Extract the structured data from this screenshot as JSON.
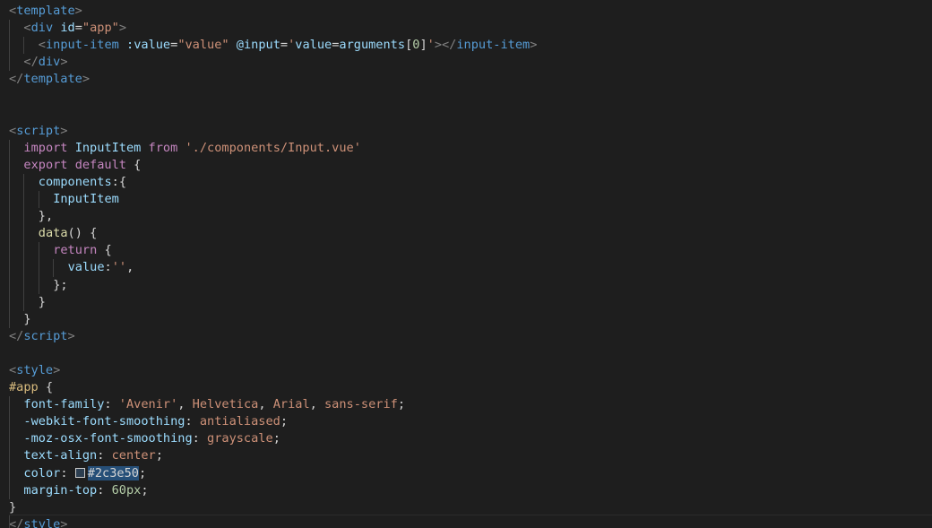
{
  "editor": {
    "language": "vue",
    "lines": [
      {
        "indent": 0,
        "tokens": [
          {
            "c": "tk-tag",
            "t": "<"
          },
          {
            "c": "tk-name",
            "t": "template"
          },
          {
            "c": "tk-tag",
            "t": ">"
          }
        ]
      },
      {
        "indent": 1,
        "tokens": [
          {
            "c": "tk-tag",
            "t": "<"
          },
          {
            "c": "tk-name",
            "t": "div"
          },
          {
            "c": "tk-plain",
            "t": " "
          },
          {
            "c": "tk-attr",
            "t": "id"
          },
          {
            "c": "tk-plain",
            "t": "="
          },
          {
            "c": "tk-str",
            "t": "\"app\""
          },
          {
            "c": "tk-tag",
            "t": ">"
          }
        ]
      },
      {
        "indent": 2,
        "tokens": [
          {
            "c": "tk-tag",
            "t": "<"
          },
          {
            "c": "tk-name",
            "t": "input-item"
          },
          {
            "c": "tk-plain",
            "t": " "
          },
          {
            "c": "tk-attr",
            "t": ":value"
          },
          {
            "c": "tk-plain",
            "t": "="
          },
          {
            "c": "tk-str",
            "t": "\"value\""
          },
          {
            "c": "tk-plain",
            "t": " "
          },
          {
            "c": "tk-attr",
            "t": "@input"
          },
          {
            "c": "tk-plain",
            "t": "="
          },
          {
            "c": "tk-str",
            "t": "'"
          },
          {
            "c": "tk-var",
            "t": "value"
          },
          {
            "c": "tk-plain",
            "t": "="
          },
          {
            "c": "tk-var",
            "t": "arguments"
          },
          {
            "c": "tk-plain",
            "t": "["
          },
          {
            "c": "tk-num",
            "t": "0"
          },
          {
            "c": "tk-plain",
            "t": "]"
          },
          {
            "c": "tk-str",
            "t": "'"
          },
          {
            "c": "tk-tag",
            "t": "></"
          },
          {
            "c": "tk-name",
            "t": "input-item"
          },
          {
            "c": "tk-tag",
            "t": ">"
          }
        ]
      },
      {
        "indent": 1,
        "tokens": [
          {
            "c": "tk-tag",
            "t": "</"
          },
          {
            "c": "tk-name",
            "t": "div"
          },
          {
            "c": "tk-tag",
            "t": ">"
          }
        ]
      },
      {
        "indent": 0,
        "tokens": [
          {
            "c": "tk-tag",
            "t": "</"
          },
          {
            "c": "tk-name",
            "t": "template"
          },
          {
            "c": "tk-tag",
            "t": ">"
          }
        ]
      },
      {
        "indent": 0,
        "tokens": []
      },
      {
        "indent": 0,
        "tokens": []
      },
      {
        "indent": 0,
        "tokens": [
          {
            "c": "tk-tag",
            "t": "<"
          },
          {
            "c": "tk-name",
            "t": "script"
          },
          {
            "c": "tk-tag",
            "t": ">"
          }
        ]
      },
      {
        "indent": 1,
        "tokens": [
          {
            "c": "tk-kw",
            "t": "import"
          },
          {
            "c": "tk-plain",
            "t": " "
          },
          {
            "c": "tk-var",
            "t": "InputItem"
          },
          {
            "c": "tk-plain",
            "t": " "
          },
          {
            "c": "tk-kw",
            "t": "from"
          },
          {
            "c": "tk-plain",
            "t": " "
          },
          {
            "c": "tk-str",
            "t": "'./components/Input.vue'"
          }
        ]
      },
      {
        "indent": 1,
        "tokens": [
          {
            "c": "tk-kw",
            "t": "export"
          },
          {
            "c": "tk-plain",
            "t": " "
          },
          {
            "c": "tk-kw",
            "t": "default"
          },
          {
            "c": "tk-plain",
            "t": " {"
          }
        ]
      },
      {
        "indent": 2,
        "tokens": [
          {
            "c": "tk-var",
            "t": "components"
          },
          {
            "c": "tk-plain",
            "t": ":{"
          }
        ]
      },
      {
        "indent": 3,
        "tokens": [
          {
            "c": "tk-var",
            "t": "InputItem"
          }
        ]
      },
      {
        "indent": 2,
        "tokens": [
          {
            "c": "tk-plain",
            "t": "},"
          }
        ]
      },
      {
        "indent": 2,
        "tokens": [
          {
            "c": "tk-fn",
            "t": "data"
          },
          {
            "c": "tk-plain",
            "t": "() {"
          }
        ]
      },
      {
        "indent": 3,
        "tokens": [
          {
            "c": "tk-kw",
            "t": "return"
          },
          {
            "c": "tk-plain",
            "t": " {"
          }
        ]
      },
      {
        "indent": 4,
        "tokens": [
          {
            "c": "tk-var",
            "t": "value"
          },
          {
            "c": "tk-plain",
            "t": ":"
          },
          {
            "c": "tk-str",
            "t": "''"
          },
          {
            "c": "tk-plain",
            "t": ","
          }
        ]
      },
      {
        "indent": 3,
        "tokens": [
          {
            "c": "tk-plain",
            "t": "};"
          }
        ]
      },
      {
        "indent": 2,
        "tokens": [
          {
            "c": "tk-plain",
            "t": "}"
          }
        ]
      },
      {
        "indent": 1,
        "tokens": [
          {
            "c": "tk-plain",
            "t": "}"
          }
        ]
      },
      {
        "indent": 0,
        "tokens": [
          {
            "c": "tk-tag",
            "t": "</"
          },
          {
            "c": "tk-name",
            "t": "script"
          },
          {
            "c": "tk-tag",
            "t": ">"
          }
        ]
      },
      {
        "indent": 0,
        "tokens": []
      },
      {
        "indent": 0,
        "tokens": [
          {
            "c": "tk-tag",
            "t": "<"
          },
          {
            "c": "tk-name",
            "t": "style"
          },
          {
            "c": "tk-tag",
            "t": ">"
          }
        ]
      },
      {
        "indent": 0,
        "tokens": [
          {
            "c": "tk-sel",
            "t": "#app"
          },
          {
            "c": "tk-plain",
            "t": " {"
          }
        ]
      },
      {
        "indent": 1,
        "tokens": [
          {
            "c": "tk-prop",
            "t": "font-family"
          },
          {
            "c": "tk-plain",
            "t": ": "
          },
          {
            "c": "tk-val",
            "t": "'Avenir'"
          },
          {
            "c": "tk-plain",
            "t": ", "
          },
          {
            "c": "tk-val",
            "t": "Helvetica"
          },
          {
            "c": "tk-plain",
            "t": ", "
          },
          {
            "c": "tk-val",
            "t": "Arial"
          },
          {
            "c": "tk-plain",
            "t": ", "
          },
          {
            "c": "tk-val",
            "t": "sans-serif"
          },
          {
            "c": "tk-plain",
            "t": ";"
          }
        ]
      },
      {
        "indent": 1,
        "tokens": [
          {
            "c": "tk-prop",
            "t": "-webkit-font-smoothing"
          },
          {
            "c": "tk-plain",
            "t": ": "
          },
          {
            "c": "tk-val",
            "t": "antialiased"
          },
          {
            "c": "tk-plain",
            "t": ";"
          }
        ]
      },
      {
        "indent": 1,
        "tokens": [
          {
            "c": "tk-prop",
            "t": "-moz-osx-font-smoothing"
          },
          {
            "c": "tk-plain",
            "t": ": "
          },
          {
            "c": "tk-val",
            "t": "grayscale"
          },
          {
            "c": "tk-plain",
            "t": ";"
          }
        ]
      },
      {
        "indent": 1,
        "tokens": [
          {
            "c": "tk-prop",
            "t": "text-align"
          },
          {
            "c": "tk-plain",
            "t": ": "
          },
          {
            "c": "tk-val",
            "t": "center"
          },
          {
            "c": "tk-plain",
            "t": ";"
          }
        ]
      },
      {
        "indent": 1,
        "tokens": [
          {
            "c": "tk-prop",
            "t": "color"
          },
          {
            "c": "tk-plain",
            "t": ": "
          },
          {
            "c": "swatch",
            "t": ""
          },
          {
            "c": "tk-plain hl",
            "t": "#2c3e50"
          },
          {
            "c": "tk-plain",
            "t": ";"
          }
        ]
      },
      {
        "indent": 1,
        "tokens": [
          {
            "c": "tk-prop",
            "t": "margin-top"
          },
          {
            "c": "tk-plain",
            "t": ": "
          },
          {
            "c": "tk-num",
            "t": "60px"
          },
          {
            "c": "tk-plain",
            "t": ";"
          }
        ]
      },
      {
        "indent": 0,
        "tokens": [
          {
            "c": "tk-plain",
            "t": "}"
          }
        ]
      },
      {
        "indent": 0,
        "tokens": [
          {
            "c": "tk-tag",
            "t": "</"
          },
          {
            "c": "tk-name",
            "t": "style"
          },
          {
            "c": "tk-tag",
            "t": ">"
          }
        ]
      }
    ],
    "swatch_color": "#2c3e50"
  }
}
